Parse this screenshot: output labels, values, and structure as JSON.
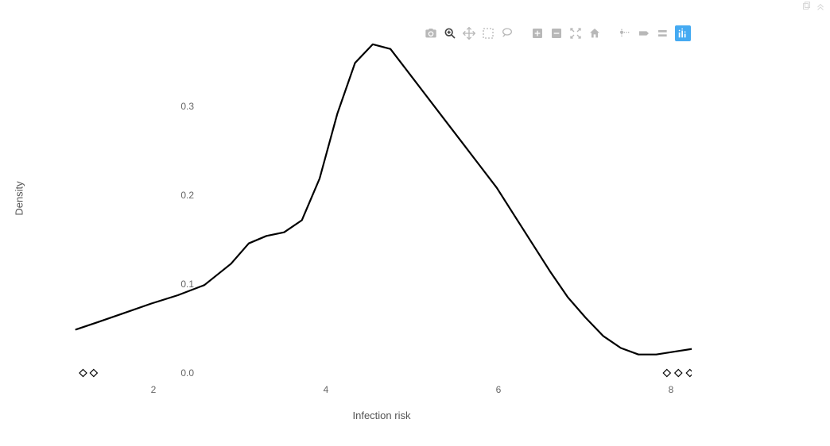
{
  "chart_data": {
    "type": "line",
    "title": "",
    "xlabel": "Infection risk",
    "ylabel": "Density",
    "xlim": [
      1.0,
      8.0
    ],
    "ylim": [
      0.0,
      0.36
    ],
    "xticks": [
      2,
      4,
      6,
      8
    ],
    "yticks": [
      0.0,
      0.1,
      0.2,
      0.3
    ],
    "series": [
      {
        "name": "density",
        "x": [
          1.05,
          1.3,
          1.6,
          1.9,
          2.2,
          2.5,
          2.8,
          3.0,
          3.2,
          3.4,
          3.6,
          3.8,
          4.0,
          4.2,
          4.4,
          4.6,
          4.8,
          5.0,
          5.2,
          5.4,
          5.6,
          5.8,
          6.0,
          6.2,
          6.4,
          6.6,
          6.8,
          7.0,
          7.2,
          7.4,
          7.6,
          7.8,
          8.0,
          8.1
        ],
        "y": [
          0.047,
          0.055,
          0.065,
          0.075,
          0.084,
          0.095,
          0.118,
          0.14,
          0.148,
          0.152,
          0.165,
          0.21,
          0.28,
          0.335,
          0.355,
          0.35,
          0.325,
          0.3,
          0.275,
          0.25,
          0.225,
          0.2,
          0.17,
          0.14,
          0.11,
          0.082,
          0.06,
          0.04,
          0.027,
          0.02,
          0.02,
          0.023,
          0.026,
          0.027
        ]
      }
    ],
    "outliers_x": [
      1.13,
      1.25,
      7.72,
      7.85,
      7.98
    ]
  },
  "axis": {
    "xlabel": "Infection risk",
    "ylabel": "Density"
  },
  "yticks": {
    "0": "0.0",
    "1": "0.1",
    "2": "0.2",
    "3": "0.3"
  },
  "xticks": {
    "0": "2",
    "1": "4",
    "2": "6",
    "3": "8"
  },
  "toolbar": {
    "camera": "camera-icon",
    "zoom": "zoom-icon",
    "pan": "pan-icon",
    "box_select": "box-select-icon",
    "lasso": "lasso-icon",
    "zoom_in": "zoom-in-icon",
    "zoom_out": "zoom-out-icon",
    "autoscale": "autoscale-icon",
    "reset": "home-icon",
    "spike": "spike-icon",
    "hover_closest": "hover-closest-icon",
    "hover_compare": "hover-compare-icon",
    "plotly": "plotly-logo-icon"
  }
}
